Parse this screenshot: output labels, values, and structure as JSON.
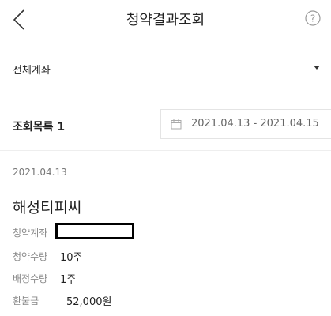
{
  "header": {
    "title": "청약결과조회",
    "back_icon": "chevron-left-icon",
    "help_icon": "question-circle-icon"
  },
  "account_filter": {
    "label": "전체계좌"
  },
  "list": {
    "title": "조회목록 1",
    "date_range": "2021.04.13 - 2021.04.15"
  },
  "result": {
    "date": "2021.04.13",
    "company": "해성티피씨",
    "fields": {
      "account_label": "청약계좌",
      "qty_label": "청약수량",
      "qty_value": "10주",
      "alloc_label": "배정수량",
      "alloc_value": "1주",
      "refund_label": "환불금",
      "refund_value": "52,000원"
    }
  }
}
